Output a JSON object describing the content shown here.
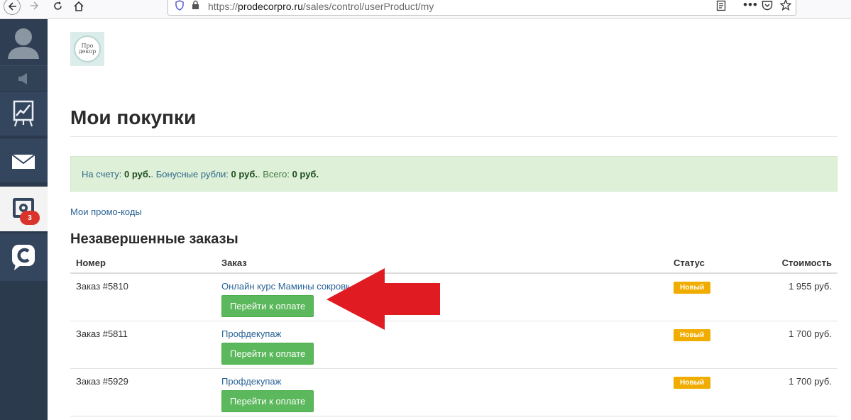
{
  "browser": {
    "url_prefix": "https://",
    "url_host": "prodecorpro.ru",
    "url_path": "/sales/control/userProduct/my"
  },
  "sidebar": {
    "notifications_badge": "3"
  },
  "logo": {
    "text_line1": "Про",
    "text_line2": "декор"
  },
  "page": {
    "title": "Мои покупки",
    "balance": {
      "label1": "На счету:",
      "value1": "0 руб.",
      "label2": ". Бонусные рубли:",
      "value2": "0 руб.",
      "label3": ". Всего:",
      "value3": "0 руб."
    },
    "promo_link": "Мои промо-коды",
    "section_title": "Незавершенные заказы"
  },
  "table": {
    "headers": [
      "Номер",
      "Заказ",
      "Статус",
      "Стоимость"
    ],
    "rows": [
      {
        "number": "Заказ #5810",
        "product": "Онлайн курс Мамины сокровища",
        "button": "Перейти к оплате",
        "status": "Новый",
        "price": "1 955 руб."
      },
      {
        "number": "Заказ #5811",
        "product": "Профдекупаж",
        "button": "Перейти к оплате",
        "status": "Новый",
        "price": "1 700 руб."
      },
      {
        "number": "Заказ #5929",
        "product": "Профдекупаж",
        "button": "Перейти к оплате",
        "status": "Новый",
        "price": "1 700 руб."
      }
    ]
  },
  "colors": {
    "sidebar_bg": "#2b3a4d",
    "success_bg": "#dff0d8",
    "pay_button": "#5cb85c",
    "status_badge": "#f0ad00",
    "annotation_arrow": "#e01b22"
  },
  "icons": [
    "back-arrow-icon",
    "forward-arrow-icon",
    "reload-icon",
    "home-icon",
    "shield-icon",
    "lock-icon",
    "reader-icon",
    "more-icon",
    "pocket-icon",
    "star-icon",
    "user-avatar-icon",
    "megaphone-icon",
    "chart-board-icon",
    "mail-icon",
    "settings-screen-icon",
    "chat-c-icon"
  ]
}
